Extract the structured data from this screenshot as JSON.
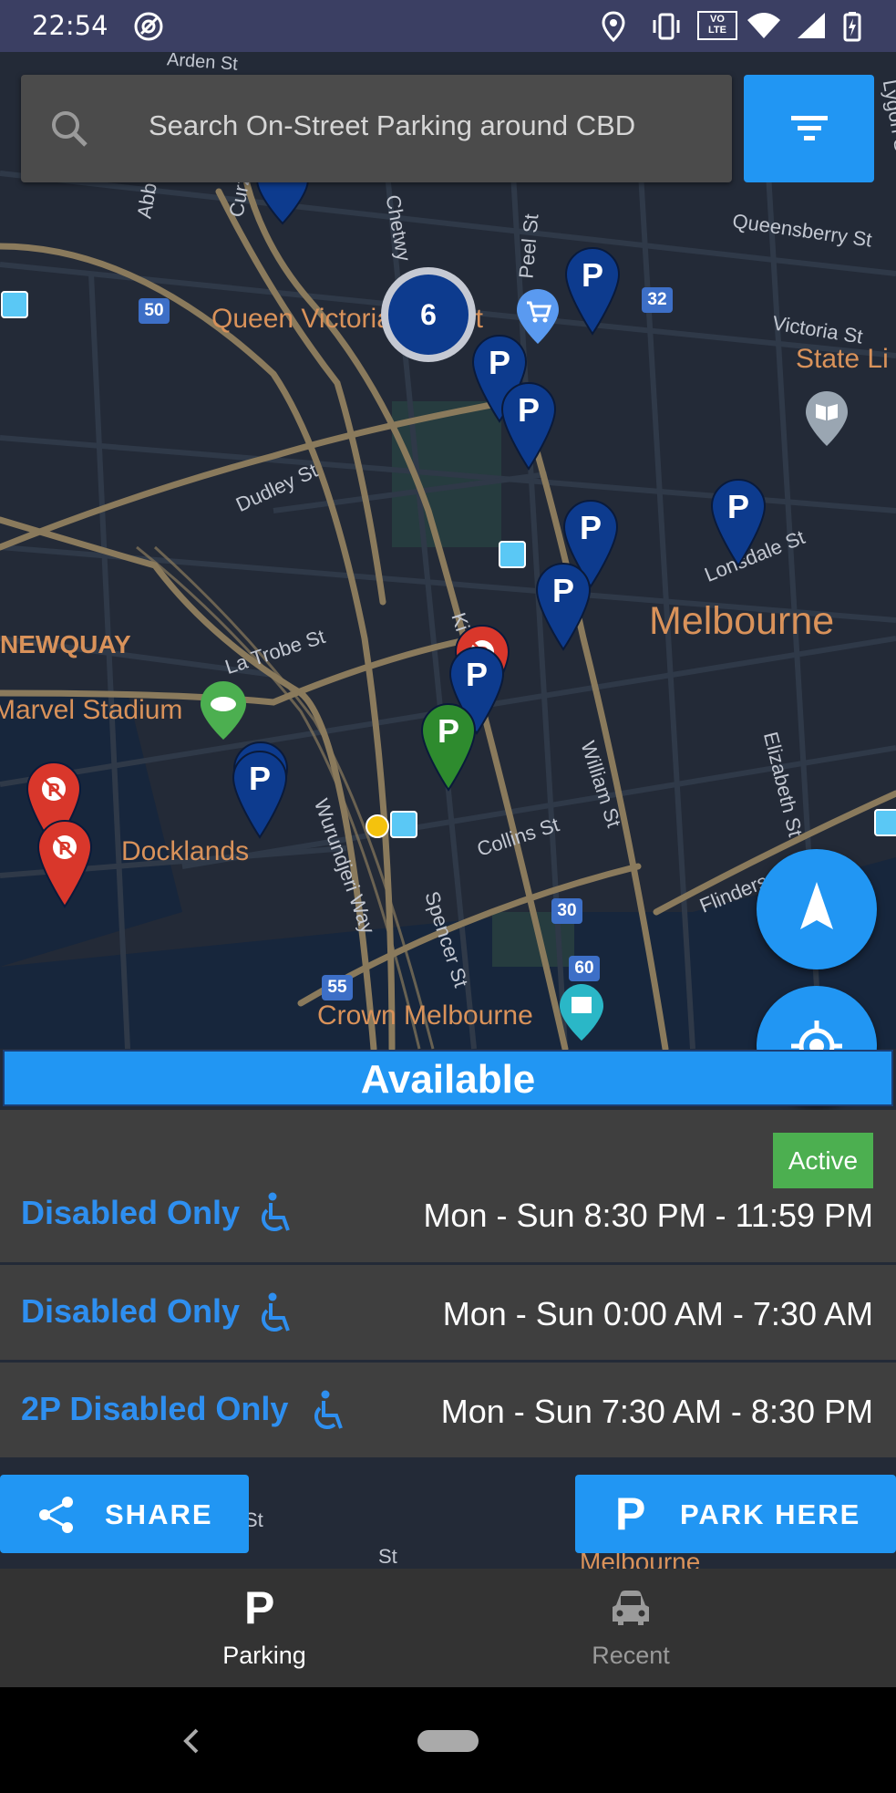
{
  "status_bar": {
    "time": "22:54",
    "volte_label": "VO\nLTE",
    "icons": [
      "at-sign-icon",
      "location-icon",
      "vibrate-icon",
      "volte-icon",
      "wifi-icon",
      "signal-icon",
      "battery-charging-icon"
    ]
  },
  "search": {
    "placeholder": "Search On-Street Parking around CBD",
    "icon": "search-icon"
  },
  "filter": {
    "icon": "filter-icon"
  },
  "map": {
    "labels": {
      "arden_st": "Arden St",
      "queen_victoria_market": "Queen Victoria Market",
      "queensberry_st": "Queensberry St",
      "victoria_st": "Victoria St",
      "state_library": "State Li",
      "dudley_st": "Dudley St",
      "lonsdale_st": "Lonsdale St",
      "melbourne": "Melbourne",
      "newquay": "NEWQUAY",
      "la_trobe_st": "La Trobe St",
      "marvel_stadium": "Marvel Stadium",
      "docklands": "Docklands",
      "wurundjeri_way": "Wurundjeri Way",
      "spencer_st": "Spencer St",
      "collins_st": "Collins St",
      "william_st": "William St",
      "elizabeth_st": "Elizabeth St",
      "flinders_st": "Flinders St",
      "crown_melbourne": "Crown Melbourne",
      "peel_st": "Peel St",
      "chetwynd": "Chetwy",
      "curzon": "Curz",
      "abbotsford": "Abb",
      "lygon_st": "Lygon St",
      "ki": "Ki",
      "melbourne_bottom": "Melbourne",
      "st_bottom": "St",
      "st_bottom2": "St"
    },
    "route_shields": [
      "50",
      "32",
      "30",
      "55",
      "60"
    ],
    "cluster_count": "6",
    "parking_pin_letter": "P"
  },
  "fabs": {
    "navigate_icon": "navigation-arrow-icon",
    "locate_icon": "my-location-icon"
  },
  "availability": "Available",
  "schedule": {
    "active_badge": "Active",
    "rows": [
      {
        "label": "Disabled Only",
        "time": "Mon - Sun 8:30 PM - 11:59 PM"
      },
      {
        "label": "Disabled Only",
        "time": "Mon - Sun 0:00 AM - 7:30 AM"
      },
      {
        "label": "2P Disabled Only",
        "time": "Mon - Sun 7:30 AM - 8:30 PM"
      }
    ]
  },
  "actions": {
    "share_label": "SHARE",
    "park_label": "PARK HERE"
  },
  "bottom_nav": {
    "items": [
      {
        "label": "Parking",
        "icon": "parking-icon",
        "active": true
      },
      {
        "label": "Recent",
        "icon": "car-icon",
        "active": false
      }
    ]
  },
  "colors": {
    "accent": "#2196f3",
    "map_bg": "#232a37",
    "active_green": "#4caf50",
    "label_blue": "#2e8ff0"
  }
}
